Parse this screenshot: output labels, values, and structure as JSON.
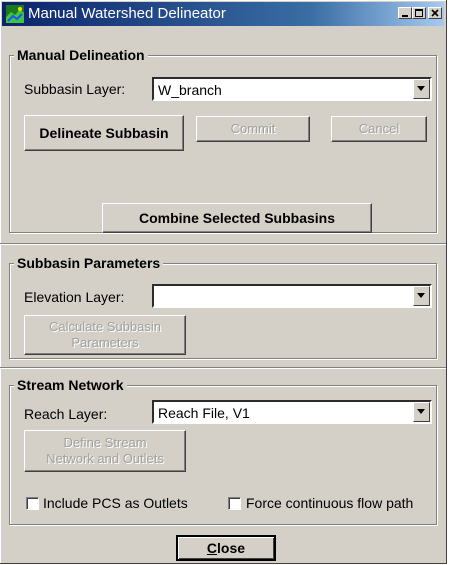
{
  "window": {
    "title": "Manual Watershed Delineator"
  },
  "manual_delineation": {
    "legend": "Manual Delineation",
    "subbasin_layer_label": "Subbasin Layer:",
    "subbasin_layer_value": "W_branch",
    "delineate_button": "Delineate Subbasin",
    "commit_button": "Commit",
    "cancel_button": "Cancel",
    "combine_button": "Combine Selected Subbasins"
  },
  "subbasin_parameters": {
    "legend": "Subbasin Parameters",
    "elevation_layer_label": "Elevation Layer:",
    "elevation_layer_value": "",
    "calculate_button_line1": "Calculate Subbasin",
    "calculate_button_line2": "Parameters"
  },
  "stream_network": {
    "legend": "Stream Network",
    "reach_layer_label": "Reach Layer:",
    "reach_layer_value": "Reach File, V1",
    "define_button_line1": "Define Stream",
    "define_button_line2": "Network and Outlets",
    "include_pcs_label": "Include PCS as Outlets",
    "force_flow_label": "Force continuous flow path"
  },
  "close_button_first": "C",
  "close_button_rest": "lose",
  "colors": {
    "titlebar_start": "#0a246a",
    "titlebar_end": "#a6caf0",
    "face": "#d4d0c8"
  }
}
